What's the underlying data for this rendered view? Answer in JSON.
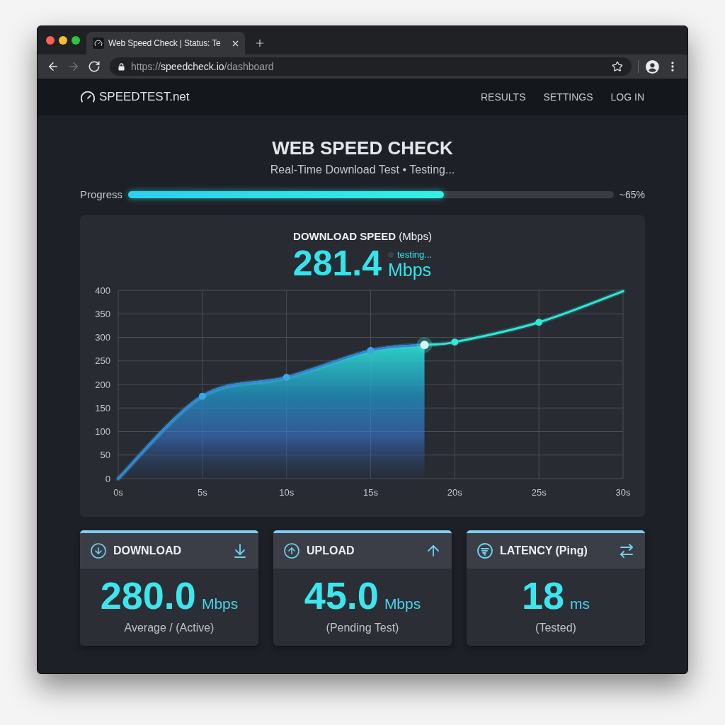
{
  "browser": {
    "tab": {
      "title": "Web Speed Check | Status: Te"
    },
    "nav_buttons": [
      {
        "kind": "back",
        "disabled": false
      },
      {
        "kind": "forward",
        "disabled": true
      },
      {
        "kind": "reload",
        "disabled": false
      }
    ],
    "address_bar": {
      "url": "https://**speedcheck.io**/dashboard"
    }
  },
  "site": {
    "logo": "SPEEDTEST.net",
    "nav": [
      "RESULTS",
      "SETTINGS",
      "LOG IN"
    ]
  },
  "hero": {
    "title": "WEB SPEED CHECK",
    "subtitle": "Real-Time Download Test • Testing..."
  },
  "progress": {
    "label": "Progress",
    "level": 0.65,
    "reading": "~65%"
  },
  "speed_card": {
    "title": "**DOWNLOAD SPEED** (Mbps)",
    "value": "281.4",
    "unit": "Mbps",
    "status": "testing...",
    "chart_data": {
      "type": "line",
      "x": [
        0,
        5,
        10,
        15,
        18.2,
        20,
        25,
        30
      ],
      "series": [
        {
          "color": "#3a7ee0",
          "values": [
            0,
            175,
            215,
            272,
            284,
            null,
            null,
            null
          ],
          "marker": true
        },
        {
          "color": "#2ee8d8",
          "values": [
            0,
            175,
            215,
            272,
            284,
            290,
            332,
            398
          ],
          "marker": true
        }
      ],
      "xlim": [
        0,
        30
      ],
      "ylim": [
        0,
        400
      ],
      "xticks": [
        {
          "value": 0,
          "label": "0s"
        },
        {
          "value": 5,
          "label": "5s"
        },
        {
          "value": 10,
          "label": "10s"
        },
        {
          "value": 15,
          "label": "15s"
        },
        {
          "value": 20,
          "label": "20s"
        },
        {
          "value": 25,
          "label": "25s"
        },
        {
          "value": 30,
          "label": "30s"
        }
      ],
      "yticks": [
        0,
        50,
        100,
        150,
        200,
        250,
        300,
        350,
        400
      ],
      "grid": true
    }
  },
  "stats": [
    {
      "kind": "download",
      "title": "DOWNLOAD",
      "value": "280.0",
      "unit": "Mbps",
      "note": "Average / (Active)"
    },
    {
      "kind": "upload",
      "title": "UPLOAD",
      "value": "45.0",
      "unit": "Mbps",
      "note": "(Pending Test)"
    },
    {
      "kind": "latency",
      "title": "LATENCY (Ping)",
      "value": "18",
      "unit": "ms",
      "note": "(Tested)"
    }
  ]
}
